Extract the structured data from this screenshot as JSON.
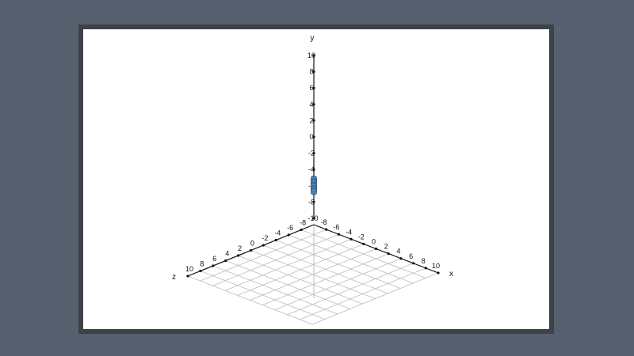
{
  "chart_data": {
    "type": "scatter",
    "title": "",
    "projection": "3d-isometric",
    "axes": {
      "x": {
        "label": "x",
        "range": [
          -10,
          10
        ],
        "ticks": [
          "-8",
          "-6",
          "-4",
          "-2",
          "0",
          "2",
          "4",
          "6",
          "8",
          "10"
        ]
      },
      "y": {
        "label": "y",
        "range": [
          -10,
          10
        ],
        "ticks": [
          "10",
          "8",
          "6",
          "4",
          "2",
          "0",
          "-2",
          "-4",
          "-6",
          "-8",
          "-10"
        ]
      },
      "z": {
        "label": "z",
        "range": [
          -10,
          10
        ],
        "ticks": [
          "10",
          "8",
          "6",
          "4",
          "2",
          "0",
          "-2",
          "-4",
          "-6",
          "-8"
        ]
      }
    },
    "grid": "on (x-z floor plane)",
    "series": [
      {
        "marker": "vertical bar",
        "color": "#4682b4",
        "points": [
          {
            "x": 0,
            "y": -5.2,
            "z": 0
          },
          {
            "x": 0,
            "y": -5.6,
            "z": 0
          },
          {
            "x": 0,
            "y": -6.0,
            "z": 0
          },
          {
            "x": 0,
            "y": -6.4,
            "z": 0
          },
          {
            "x": 0,
            "y": -6.7,
            "z": 0
          }
        ]
      }
    ]
  },
  "colors": {
    "desktop": "#56606f",
    "frame_border": "#3d4148",
    "canvas": "#ffffff",
    "grid": "#bbbbbb",
    "axis": "#111111",
    "marker": "#4682b4"
  }
}
